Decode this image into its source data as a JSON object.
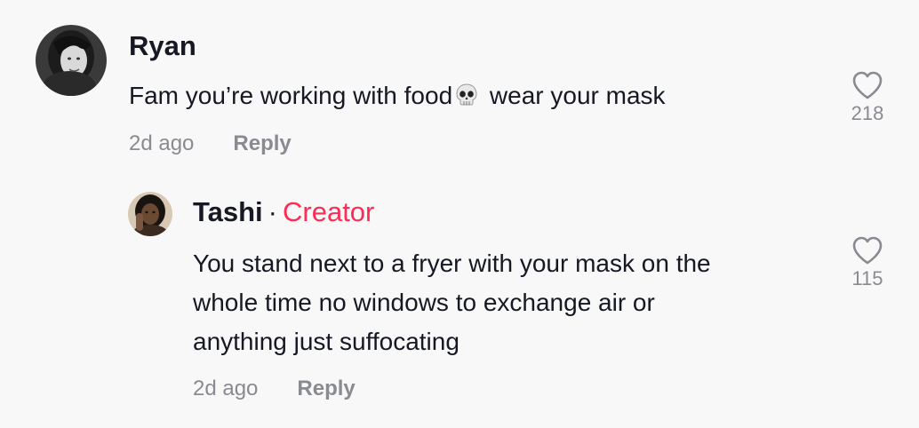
{
  "comments": [
    {
      "username": "Ryan",
      "text_before_emoji": "Fam you’re working with food",
      "emoji": "skull-emoji",
      "text_after_emoji": " wear your mask",
      "age": "2d ago",
      "reply_label": "Reply",
      "like_count": "218",
      "like_icon": "heart-outline-icon"
    }
  ],
  "replies": [
    {
      "username": "Tashi",
      "separator": "·",
      "badge": "Creator",
      "line1": "You stand next to a fryer with your mask on the",
      "line2": "whole time no windows to exchange air or",
      "line3": "anything just suffocating",
      "age": "2d ago",
      "reply_label": "Reply",
      "like_count": "115",
      "like_icon": "heart-outline-icon"
    }
  ],
  "colors": {
    "background": "#f8f8f8",
    "primary_text": "#161823",
    "secondary_text": "#8a8b91",
    "creator_badge": "#fe2c55"
  }
}
